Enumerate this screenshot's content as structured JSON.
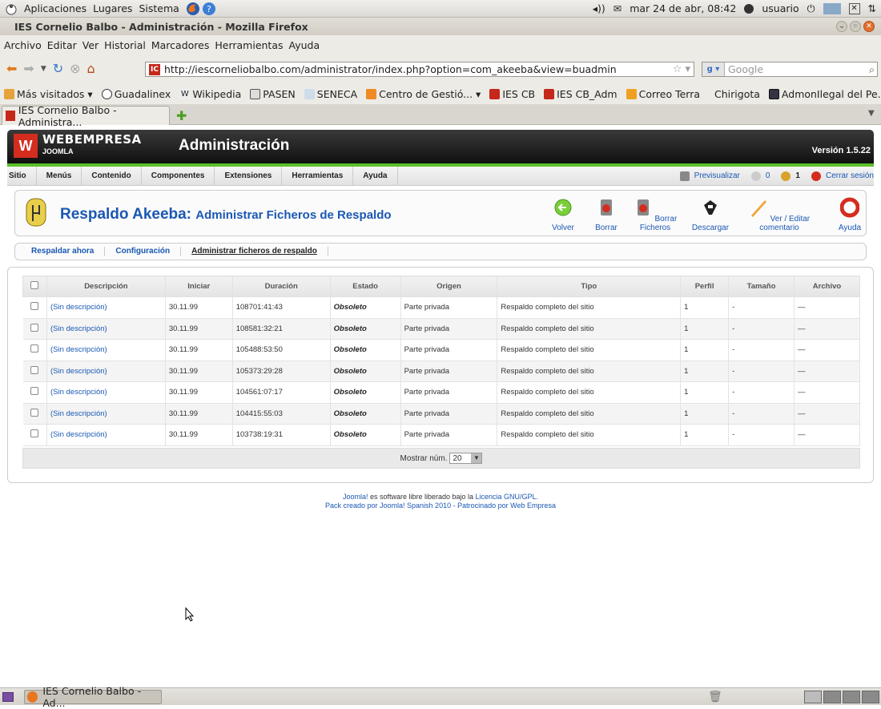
{
  "gnome_panel": {
    "menus": [
      "Aplicaciones",
      "Lugares",
      "Sistema"
    ],
    "clock": "mar 24 de abr, 08:42",
    "user": "usuario"
  },
  "window": {
    "title": "IES Cornelio Balbo - Administración - Mozilla Firefox"
  },
  "browser_menu": [
    "Archivo",
    "Editar",
    "Ver",
    "Historial",
    "Marcadores",
    "Herramientas",
    "Ayuda"
  ],
  "url": "http://iescorneliobalbo.com/administrator/index.php?option=com_akeeba&view=buadmin",
  "search": {
    "placeholder": "Google"
  },
  "bookmarks": [
    "Más visitados ▾",
    "Guadalinex",
    "Wikipedia",
    "PASEN",
    "SENECA",
    "Centro de Gestió... ▾",
    "IES CB",
    "IES CB_Adm",
    "Correo Terra",
    "Chirigota",
    "AdmonIlegal del Pe..."
  ],
  "tab": {
    "label": "IES Cornelio Balbo - Administra..."
  },
  "joomla": {
    "brand": "WEBEMPRESA",
    "brand_sub": "JOOMLA",
    "header_title": "Administración",
    "version": "Versión 1.5.22",
    "menu": [
      "Sitio",
      "Menús",
      "Contenido",
      "Componentes",
      "Extensiones",
      "Herramientas",
      "Ayuda"
    ],
    "status": {
      "preview": "Previsualizar",
      "messages": "0",
      "users": "1",
      "logout": "Cerrar sesión"
    }
  },
  "toolbar": {
    "title_main": "Respaldo Akeeba:",
    "title_sub": "Administrar Ficheros de Respaldo",
    "buttons": [
      "Volver",
      "Borrar",
      "Borrar Ficheros",
      "Descargar",
      "Ver / Editar comentario",
      "Ayuda"
    ]
  },
  "submenu": [
    "Respaldar ahora",
    "Configuración",
    "Administrar ficheros de respaldo"
  ],
  "table": {
    "headers": [
      "Descripción",
      "Iniciar",
      "Duración",
      "Estado",
      "Origen",
      "Tipo",
      "Perfil",
      "Tamaño",
      "Archivo"
    ],
    "rows": [
      {
        "desc": "(Sin descripción)",
        "start": "30.11.99",
        "dur": "108701:41:43",
        "state": "Obsoleto",
        "origin": "Parte privada",
        "type": "Respaldo completo del sitio",
        "profile": "1",
        "size": "-",
        "file": "—"
      },
      {
        "desc": "(Sin descripción)",
        "start": "30.11.99",
        "dur": "108581:32:21",
        "state": "Obsoleto",
        "origin": "Parte privada",
        "type": "Respaldo completo del sitio",
        "profile": "1",
        "size": "-",
        "file": "—"
      },
      {
        "desc": "(Sin descripción)",
        "start": "30.11.99",
        "dur": "105488:53:50",
        "state": "Obsoleto",
        "origin": "Parte privada",
        "type": "Respaldo completo del sitio",
        "profile": "1",
        "size": "-",
        "file": "—"
      },
      {
        "desc": "(Sin descripción)",
        "start": "30.11.99",
        "dur": "105373:29:28",
        "state": "Obsoleto",
        "origin": "Parte privada",
        "type": "Respaldo completo del sitio",
        "profile": "1",
        "size": "-",
        "file": "—"
      },
      {
        "desc": "(Sin descripción)",
        "start": "30.11.99",
        "dur": "104561:07:17",
        "state": "Obsoleto",
        "origin": "Parte privada",
        "type": "Respaldo completo del sitio",
        "profile": "1",
        "size": "-",
        "file": "—"
      },
      {
        "desc": "(Sin descripción)",
        "start": "30.11.99",
        "dur": "104415:55:03",
        "state": "Obsoleto",
        "origin": "Parte privada",
        "type": "Respaldo completo del sitio",
        "profile": "1",
        "size": "-",
        "file": "—"
      },
      {
        "desc": "(Sin descripción)",
        "start": "30.11.99",
        "dur": "103738:19:31",
        "state": "Obsoleto",
        "origin": "Parte privada",
        "type": "Respaldo completo del sitio",
        "profile": "1",
        "size": "-",
        "file": "—"
      }
    ],
    "footer_label": "Mostrar núm.",
    "page_size": "20"
  },
  "footer": {
    "line1_link1": "Joomla!",
    "line1_text": " es software libre liberado bajo la ",
    "line1_link2": "Licencia GNU/GPL.",
    "line2_link1": "Pack creado por Joomla! Spanish 2010",
    "line2_sep": " - ",
    "line2_link2": "Patrocinado por Web Empresa"
  },
  "taskbar": {
    "window_label": "IES Cornelio Balbo - Ad..."
  },
  "colors": {
    "joomla_green": "#5bbf2a",
    "link_blue": "#1a58b3",
    "logo_red": "#d42d1f"
  }
}
